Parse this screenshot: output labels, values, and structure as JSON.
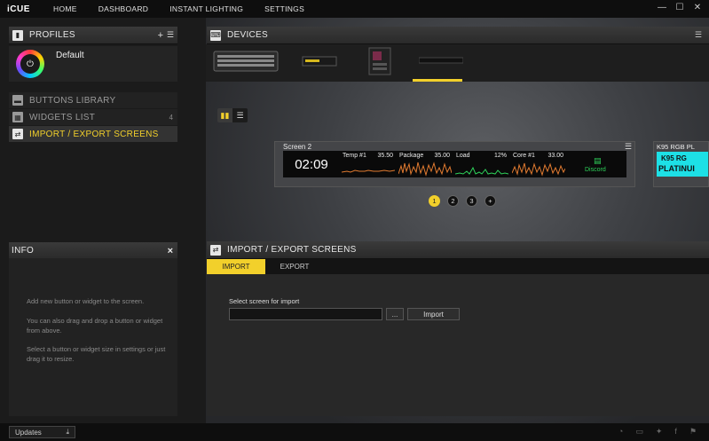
{
  "app": {
    "name": "iCUE"
  },
  "nav": [
    "HOME",
    "DASHBOARD",
    "INSTANT LIGHTING",
    "SETTINGS"
  ],
  "profiles": {
    "title": "PROFILES",
    "add_icon": "plus-icon",
    "menu_icon": "list-icon",
    "items": [
      {
        "name": "Default"
      }
    ]
  },
  "menu": [
    {
      "label": "BUTTONS LIBRARY",
      "icon": "buttons-icon",
      "count": ""
    },
    {
      "label": "WIDGETS LIST",
      "icon": "grid-icon",
      "count": "4"
    },
    {
      "label": "IMPORT / EXPORT SCREENS",
      "icon": "swap-icon",
      "count": "",
      "active": true
    }
  ],
  "info": {
    "title": "INFO",
    "paragraphs": [
      "Add new button or widget to the screen.",
      "You can also drag and drop a button or widget from above.",
      "Select a button or widget size in settings or just drag it to resize."
    ]
  },
  "devices": {
    "title": "DEVICES",
    "items": [
      "keyboard",
      "memory",
      "motherboard",
      "touchscreen"
    ],
    "selected_index": 3
  },
  "screen": {
    "name": "Screen 2",
    "time": "02:09",
    "widgets": [
      {
        "label": "Temp #1",
        "value": "35.50",
        "color": "#e07a30"
      },
      {
        "label": "Package",
        "value": "35.00",
        "color": "#e07a30"
      },
      {
        "label": "Load",
        "value": "12%",
        "color": "#2ed15a"
      },
      {
        "label": "Core #1",
        "value": "33.00",
        "color": "#e07a30"
      }
    ],
    "discord_label": "Discord"
  },
  "pager": {
    "pages": [
      "1",
      "2",
      "3"
    ],
    "active": "1",
    "add": "+"
  },
  "peek": {
    "title": "K95 RGB PL",
    "line1": "K95 RG",
    "line2": "PLATINUI"
  },
  "import_export": {
    "title": "IMPORT / EXPORT SCREENS",
    "tabs": [
      "IMPORT",
      "EXPORT"
    ],
    "active_tab": "IMPORT",
    "field_label": "Select screen for import",
    "file_value": "",
    "browse_label": "...",
    "import_label": "Import"
  },
  "footer": {
    "updates_label": "Updates"
  },
  "colors": {
    "accent": "#f2d02b",
    "panel": "#1b1b1b",
    "orange": "#e07a30",
    "green": "#2ed15a",
    "cyan": "#1de0e6"
  }
}
